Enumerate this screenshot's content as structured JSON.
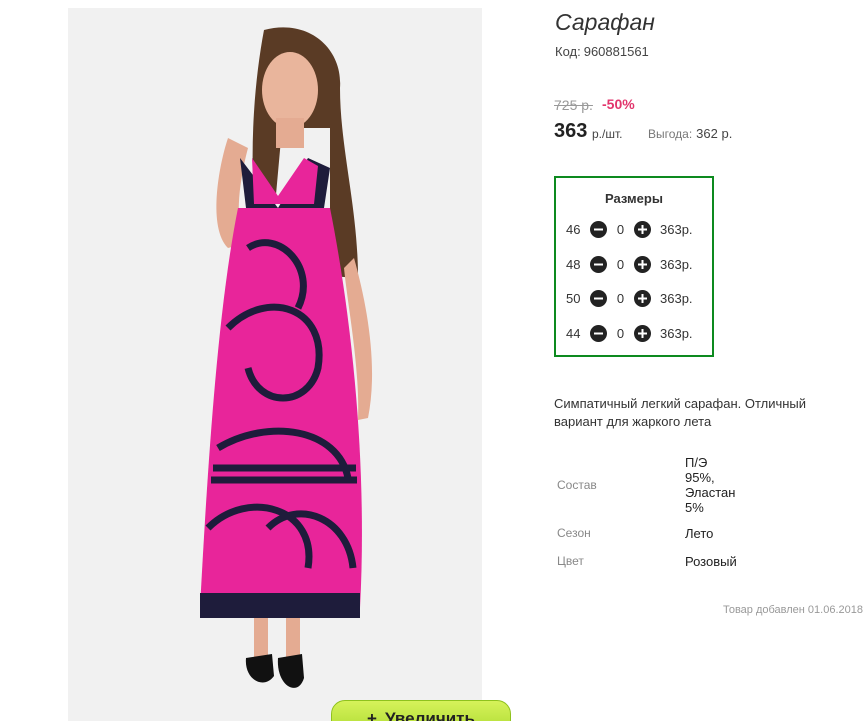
{
  "product": {
    "title": "Сарафан",
    "sku_label": "Код:",
    "sku": "960881561",
    "old_price": "725 р.",
    "discount": "-50%",
    "price": "363",
    "price_unit": "р./шт.",
    "savings_label": "Выгода:",
    "savings_value": "362 р."
  },
  "sizes": {
    "title": "Размеры",
    "rows": [
      {
        "size": "46",
        "qty": "0",
        "price": "363р."
      },
      {
        "size": "48",
        "qty": "0",
        "price": "363р."
      },
      {
        "size": "50",
        "qty": "0",
        "price": "363р."
      },
      {
        "size": "44",
        "qty": "0",
        "price": "363р."
      }
    ]
  },
  "description": "Симпатичный легкий сарафан. Отличный вариант для жаркого лета",
  "specs": {
    "composition_label": "Состав",
    "composition_value": "П/Э\n95%,\nЭластан\n5%",
    "season_label": "Сезон",
    "season_value": "Лето",
    "color_label": "Цвет",
    "color_value": "Розовый"
  },
  "added": "Товар добавлен 01.06.2018",
  "zoom": {
    "icon": "plus-icon",
    "label": "Увеличить"
  },
  "icons": {
    "minus": "minus-icon",
    "plus": "plus-icon"
  },
  "colors": {
    "sizes_border": "#0d8a1f",
    "discount": "#e2356c",
    "zoom_button": "#a7d82c",
    "dress": "#e8259a"
  }
}
